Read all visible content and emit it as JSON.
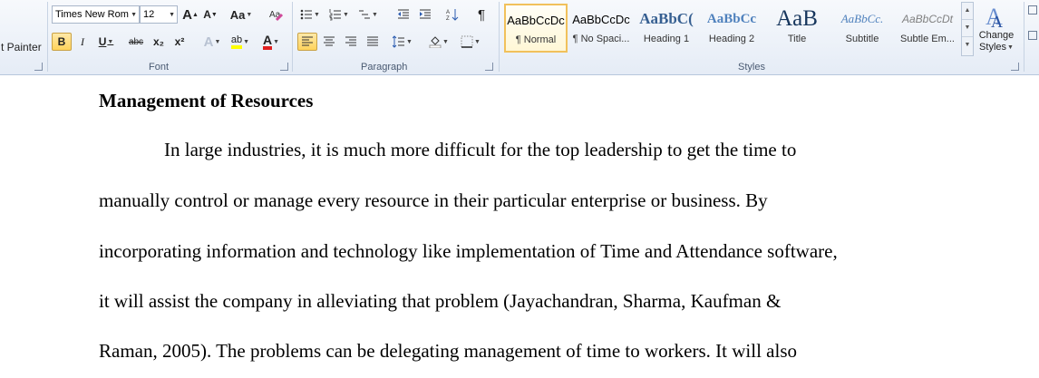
{
  "clipboard": {
    "format_painter_label": "t Painter"
  },
  "font": {
    "group_label": "Font",
    "font_name": "Times New Rom",
    "font_size": "12",
    "grow_label": "A",
    "shrink_label": "A",
    "change_case_label": "Aa",
    "bold_label": "B",
    "italic_label": "I",
    "underline_label": "U",
    "strike_label": "abc",
    "subscript_label": "x₂",
    "superscript_label": "x²",
    "effects_label": "A",
    "highlight_label": "ab",
    "font_color_label": "A"
  },
  "paragraph": {
    "group_label": "Paragraph"
  },
  "styles": {
    "group_label": "Styles",
    "items": [
      {
        "sample": "AaBbCcDc",
        "name": "¶ Normal"
      },
      {
        "sample": "AaBbCcDc",
        "name": "¶ No Spaci..."
      },
      {
        "sample": "AaBbC(",
        "name": "Heading 1"
      },
      {
        "sample": "AaBbCc",
        "name": "Heading 2"
      },
      {
        "sample": "AaB",
        "name": "Title"
      },
      {
        "sample": "AaBbCc.",
        "name": "Subtitle"
      },
      {
        "sample": "AaBbCcDt",
        "name": "Subtle Em..."
      }
    ],
    "change_styles_line1": "Change",
    "change_styles_line2": "Styles"
  },
  "colors": {
    "accent": "#f1c15b",
    "ribbon_border": "#b7c7dc",
    "heading1": "#365f91",
    "font_red": "#e02020",
    "highlight_yellow": "#ffff00"
  },
  "document": {
    "heading": "Management of Resources",
    "lines": [
      "In large industries, it is much more difficult for the top leadership to get the time to",
      "manually control or manage every resource in their particular enterprise or business. By",
      "incorporating information and technology like implementation of Time and Attendance software,",
      "it will assist the company in alleviating that problem (Jayachandran, Sharma, Kaufman &",
      "Raman, 2005). The problems can be delegating management of time to workers. It will also"
    ]
  }
}
